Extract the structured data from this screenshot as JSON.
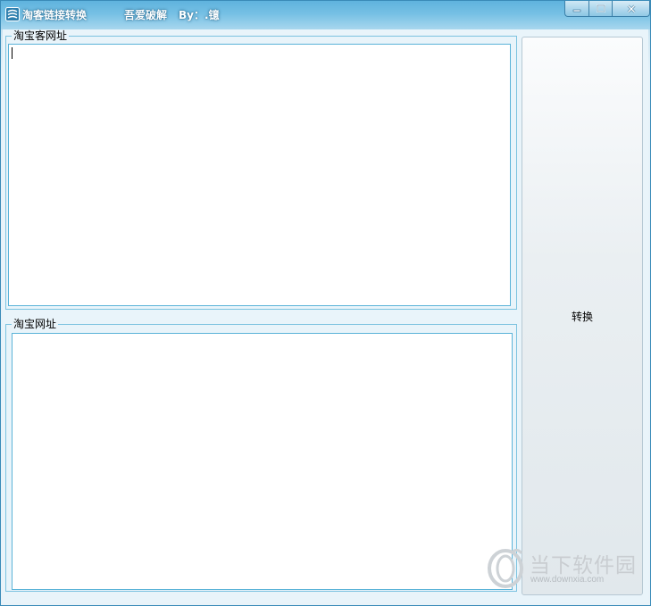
{
  "window": {
    "app_title": "淘客链接转换",
    "credit": "吾爱破解",
    "by_line": "By：.镱"
  },
  "controls": {
    "minimize_icon": "minimize-icon",
    "maximize_icon": "maximize-icon",
    "close_icon": "close-icon"
  },
  "groups": {
    "taoke_url": {
      "label": "淘宝客网址",
      "value": ""
    },
    "taobao_url": {
      "label": "淘宝网址",
      "value": ""
    }
  },
  "convert_button": {
    "label": "转换"
  },
  "watermark": {
    "brand": "当下软件园",
    "url": "www.downxia.com"
  },
  "colors": {
    "titlebar": "#76c0e4",
    "frame": "#3a8bb8",
    "group_border": "#7cc3e0",
    "textbox_border": "#5ab3d8"
  }
}
